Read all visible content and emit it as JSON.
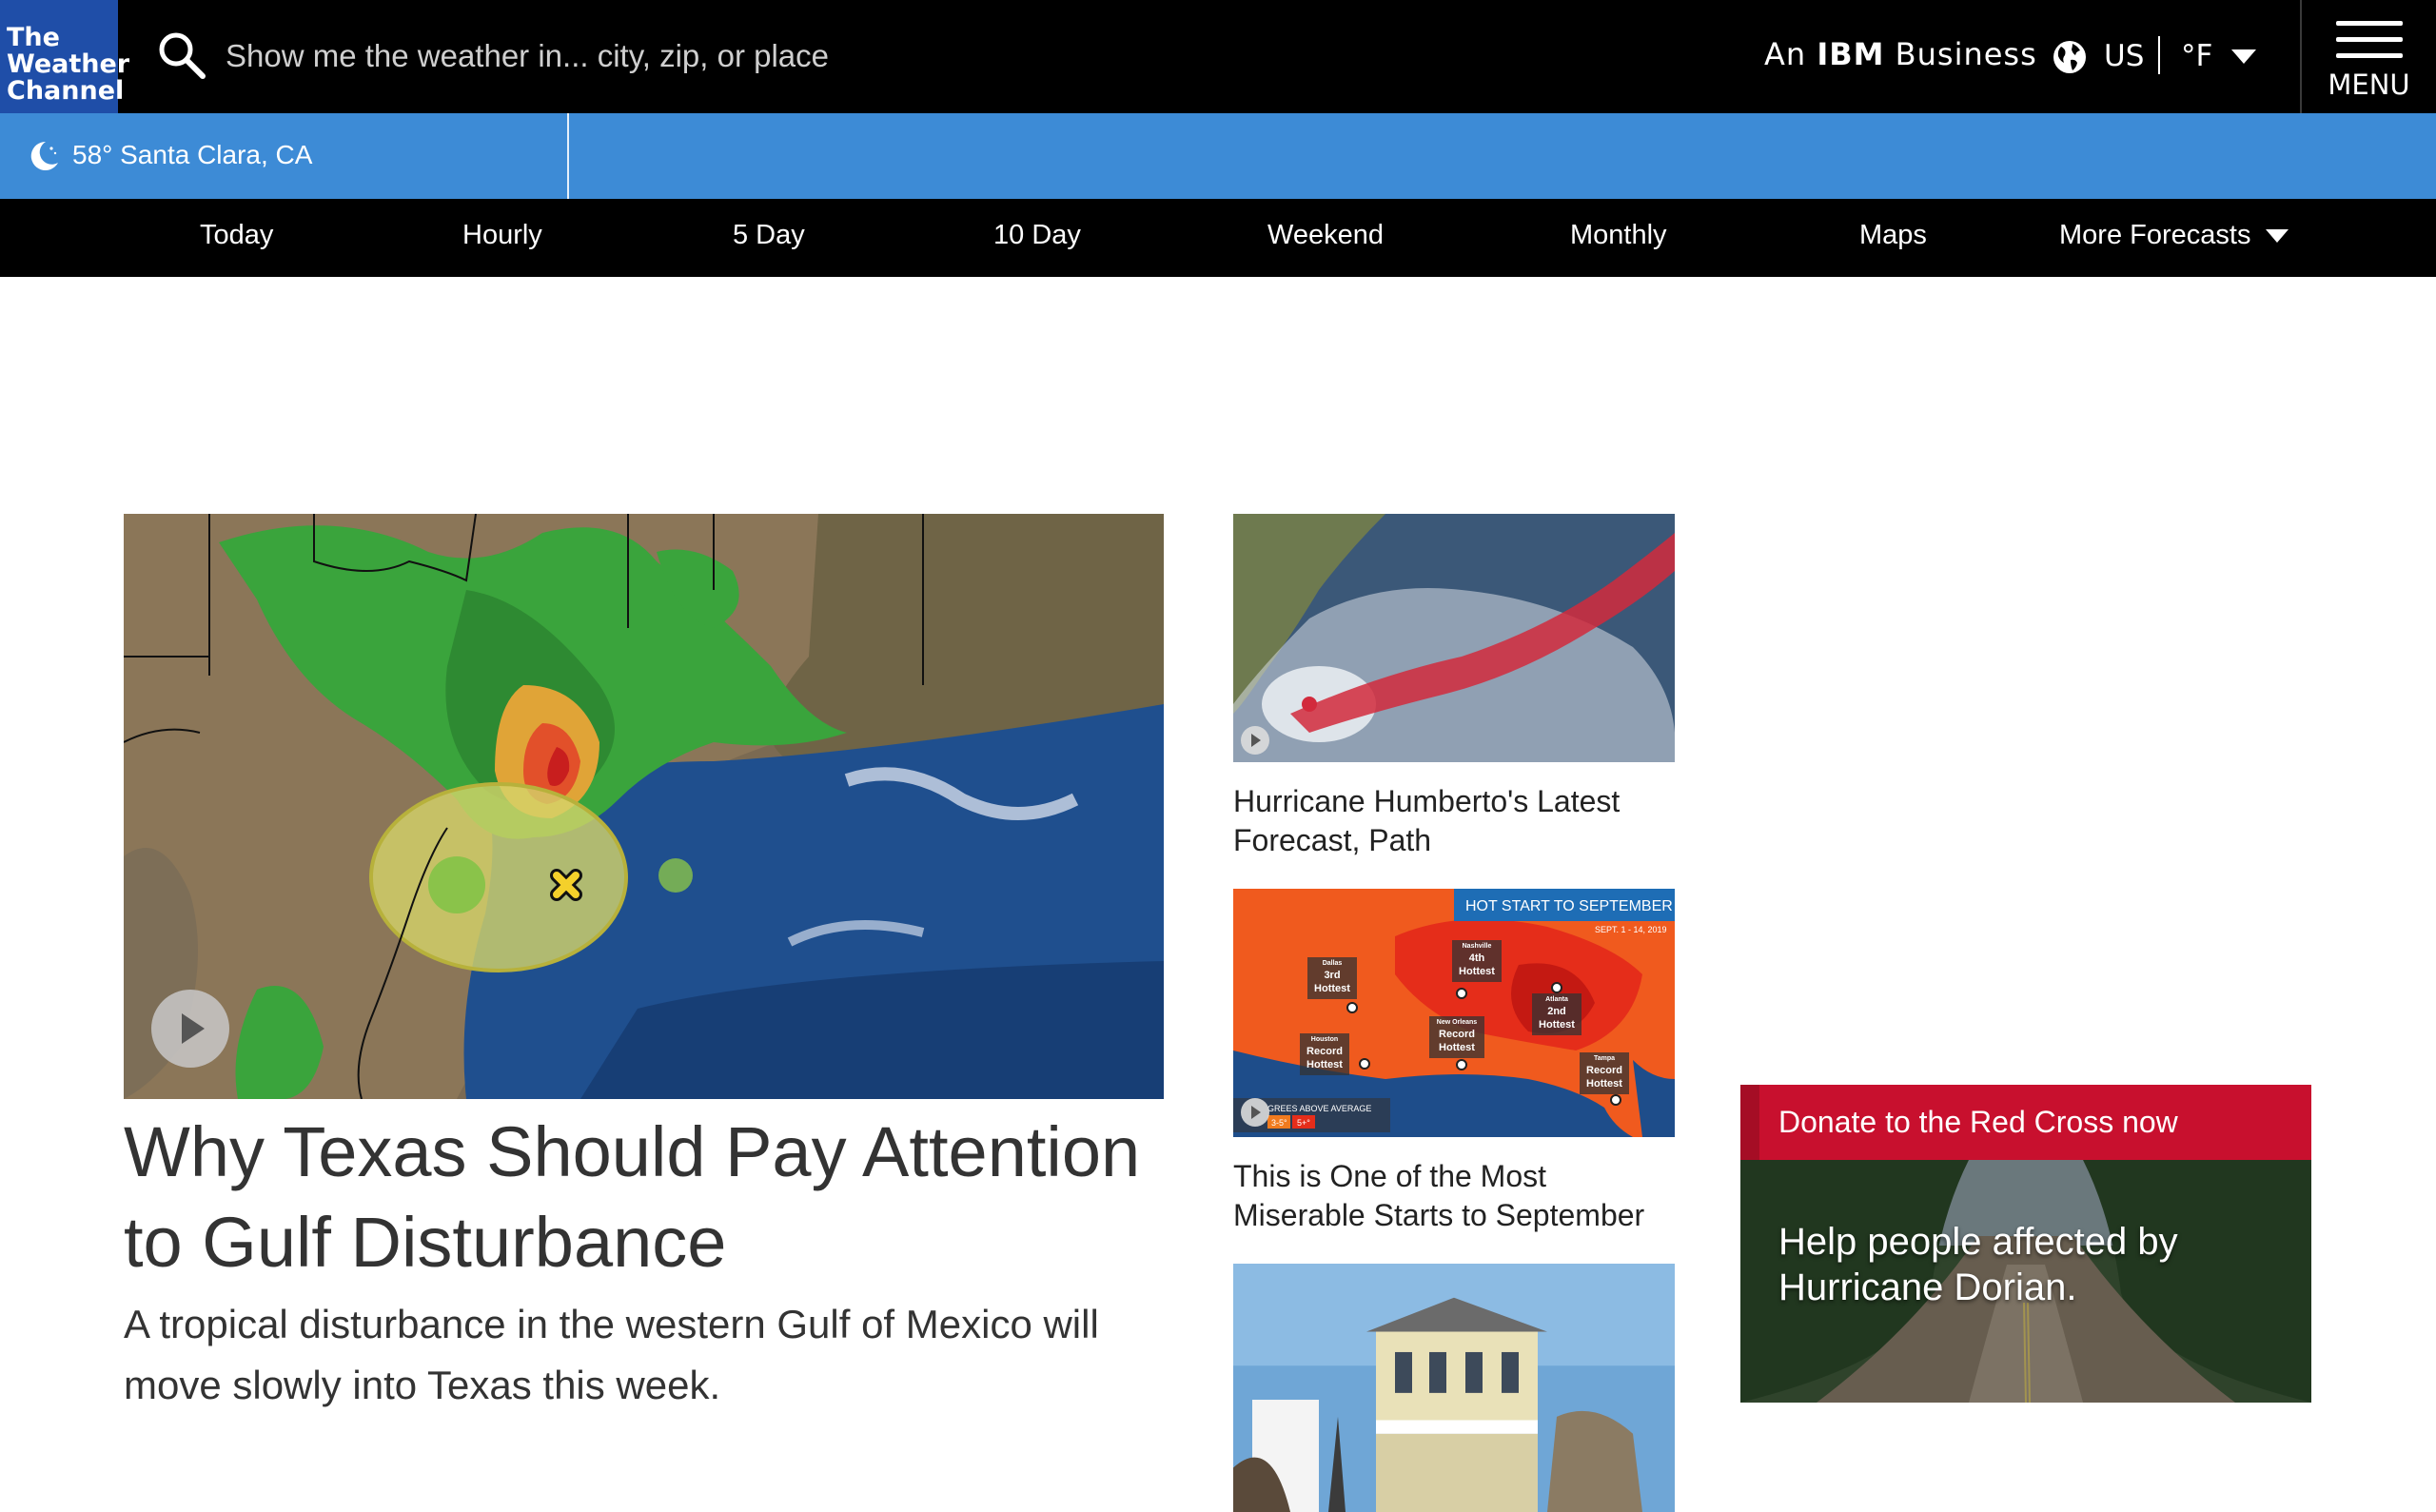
{
  "header": {
    "logo_lines": [
      "The",
      "Weather",
      "Channel"
    ],
    "search_placeholder": "Show me the weather in... city, zip, or place",
    "ibm_prefix": "An ",
    "ibm_bold": "IBM",
    "ibm_suffix": " Business",
    "locale": "US",
    "unit": "°F",
    "menu_label": "MENU"
  },
  "location": {
    "temp": "58°",
    "place": "Santa Clara, CA"
  },
  "nav": {
    "items": [
      "Today",
      "Hourly",
      "5 Day",
      "10 Day",
      "Weekend",
      "Monthly",
      "Maps",
      "More Forecasts"
    ]
  },
  "hero": {
    "title": "Why Texas Should Pay Attention to Gulf Disturbance",
    "subtitle": "A tropical disturbance in the western Gulf of Mexico will move slowly into Texas this week."
  },
  "cards": [
    {
      "title": "Hurricane Humberto's Latest Forecast, Path"
    },
    {
      "title": "This is One of the Most Miserable Starts to September",
      "map_header": "HOT START TO SEPTEMBER",
      "map_dates": "SEPT. 1 - 14, 2019",
      "map_labels": [
        [
          "Dallas",
          "3rd",
          "Hottest"
        ],
        [
          "Nashville",
          "4th",
          "Hottest"
        ],
        [
          "Atlanta",
          "2nd",
          "Hottest"
        ],
        [
          "New Orleans",
          "Record",
          "Hottest"
        ],
        [
          "Houston",
          "Record",
          "Hottest"
        ],
        [
          "Tampa",
          "Record",
          "Hottest"
        ]
      ],
      "map_legend": "GREES ABOVE AVERAGE",
      "map_legend_values": [
        "3-5°",
        "5+°"
      ]
    },
    {
      "title": ""
    }
  ],
  "ad": {
    "header": "Donate to the Red Cross now",
    "body": "Help people affected by Hurricane Dorian."
  },
  "colors": {
    "logo_bg": "#1f4ea8",
    "location_bar": "#3d8bd6",
    "red_cross": "#c8102e"
  }
}
